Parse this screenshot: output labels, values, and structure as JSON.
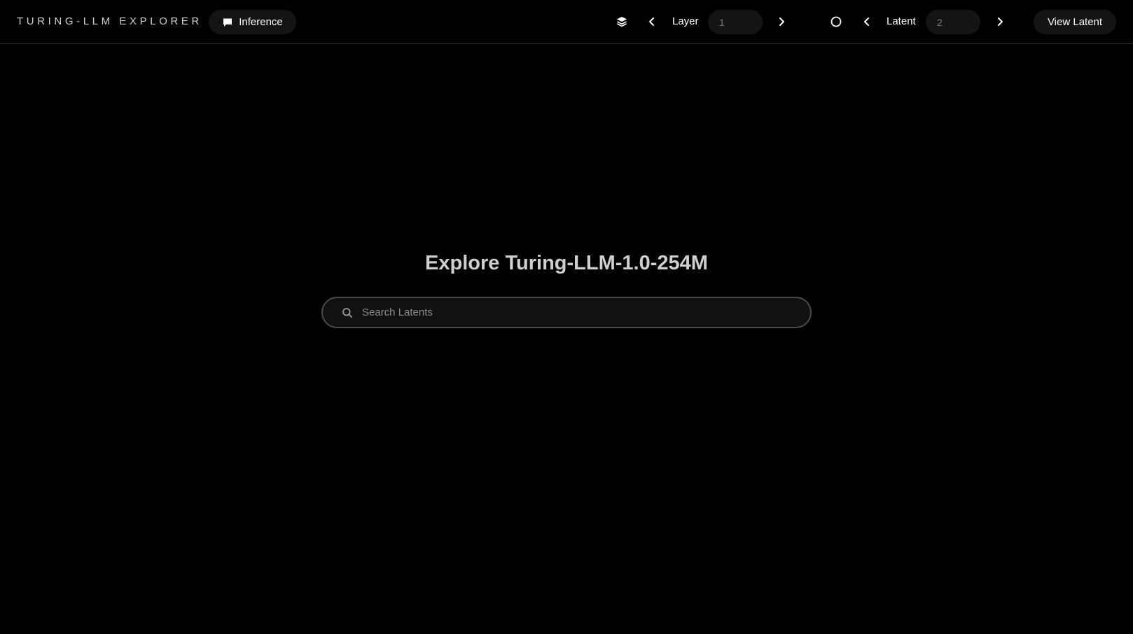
{
  "header": {
    "brand": "TURING-LLM EXPLORER",
    "inference_label": "Inference",
    "layer": {
      "label": "Layer",
      "placeholder": "1",
      "icon": "layers-icon"
    },
    "latent": {
      "label": "Latent",
      "placeholder": "2",
      "icon": "circle-icon"
    },
    "view_latent_label": "View Latent"
  },
  "main": {
    "title": "Explore Turing-LLM-1.0-254M",
    "search": {
      "placeholder": "Search Latents",
      "value": ""
    }
  },
  "colors": {
    "background": "#000000",
    "button_bg": "#141414",
    "title": "#cfcfcf",
    "search_border": "#4a4a4a"
  }
}
